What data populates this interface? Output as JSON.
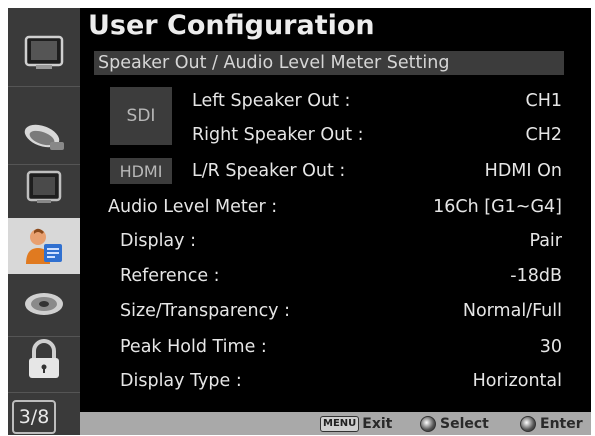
{
  "window": {
    "title": "User Configuration"
  },
  "sidebar": {
    "items": [
      {
        "icon": "monitor-icon"
      },
      {
        "icon": "satellite-dish-icon"
      },
      {
        "icon": "screen-icon"
      },
      {
        "icon": "user-config-icon",
        "active": true
      },
      {
        "icon": "disc-icon"
      },
      {
        "icon": "lock-icon"
      }
    ],
    "page_indicator": "3/8"
  },
  "section": {
    "header": "Speaker Out / Audio Level Meter Setting"
  },
  "source_labels": {
    "sdi": "SDI",
    "hdmi": "HDMI"
  },
  "settings": [
    {
      "label": "Left Speaker Out :",
      "value": "CH1"
    },
    {
      "label": "Right Speaker Out :",
      "value": "CH2"
    },
    {
      "label": "L/R Speaker Out :",
      "value": "HDMI On"
    },
    {
      "label": "Audio Level Meter :",
      "value": "16Ch [G1~G4]"
    },
    {
      "label": "Display :",
      "value": "Pair"
    },
    {
      "label": "Reference :",
      "value": "-18dB"
    },
    {
      "label": "Size/Transparency :",
      "value": "Normal/Full"
    },
    {
      "label": "Peak Hold Time :",
      "value": "30"
    },
    {
      "label": "Display Type :",
      "value": "Horizontal"
    }
  ],
  "footer": {
    "menu_key": "MENU",
    "exit_label": "Exit",
    "select_label": "Select",
    "enter_label": "Enter"
  },
  "colors": {
    "background": "#000000",
    "sidebar": "#3a3a3a",
    "active_item": "#d8d8d8",
    "footer": "#a9a9a9",
    "text": "#e6e6e6"
  }
}
